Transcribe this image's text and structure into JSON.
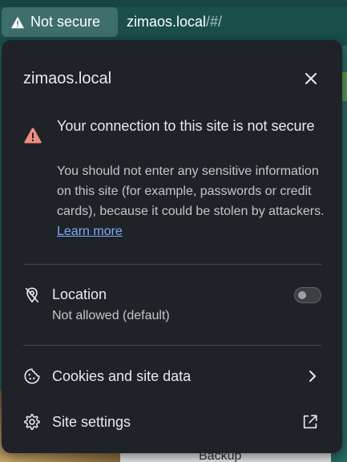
{
  "address_bar": {
    "security_chip_label": "Not secure",
    "url_host": "zimaos.local",
    "url_path": "/#/"
  },
  "background_page": {
    "partial_label": "Backup"
  },
  "popup": {
    "site_name": "zimaos.local",
    "warning": {
      "heading": "Your connection to this site is not secure",
      "body": "You should not enter any sensitive information on this site (for example, passwords or credit cards), because it could be stolen by attackers.",
      "learn_more_label": "Learn more"
    },
    "location": {
      "label": "Location",
      "status": "Not allowed (default)",
      "enabled": false
    },
    "cookies": {
      "label": "Cookies and site data"
    },
    "site_settings": {
      "label": "Site settings"
    }
  },
  "colors": {
    "popup_background": "#1f2328",
    "warning_red": "#f28b82",
    "link_blue": "#7cacf8",
    "address_bar": "#1a4f4b"
  },
  "icons": {
    "security_chip": "warning-triangle-icon",
    "close": "close-icon",
    "warning": "warning-triangle-icon",
    "location": "location-off-icon",
    "cookies": "cookie-icon",
    "cookies_action": "chevron-right-icon",
    "site_settings": "gear-icon",
    "site_settings_action": "external-link-icon"
  }
}
